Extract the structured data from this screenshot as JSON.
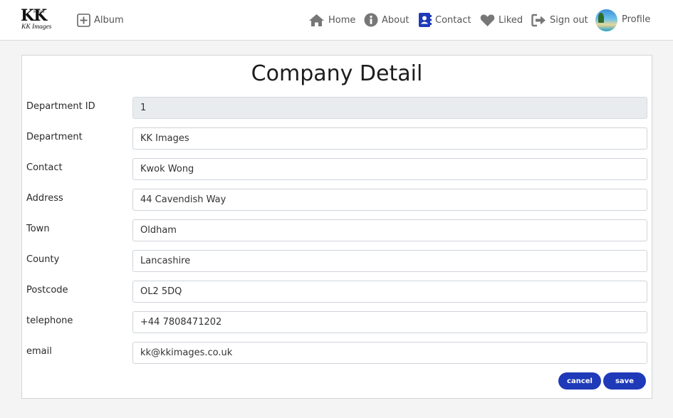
{
  "navbar": {
    "logo_text": "KK",
    "logo_small": "IMAGES",
    "logo_sub": "KK Images",
    "album_label": "Album",
    "home_label": "Home",
    "about_label": "About",
    "contact_label": "Contact",
    "liked_label": "Liked",
    "signout_label": "Sign out",
    "profile_label": "Profile"
  },
  "form": {
    "title": "Company Detail",
    "fields": [
      {
        "label": "Department ID",
        "value": "1",
        "readonly": true
      },
      {
        "label": "Department",
        "value": "KK Images"
      },
      {
        "label": "Contact",
        "value": "Kwok Wong"
      },
      {
        "label": "Address",
        "value": "44 Cavendish Way"
      },
      {
        "label": "Town",
        "value": "Oldham"
      },
      {
        "label": "County",
        "value": "Lancashire"
      },
      {
        "label": "Postcode",
        "value": "OL2 5DQ"
      },
      {
        "label": "telephone",
        "value": "+44 7808471202"
      },
      {
        "label": "email",
        "value": "kk@kkimages.co.uk"
      }
    ],
    "cancel_label": "cancel",
    "save_label": "save"
  },
  "colors": {
    "primary_button": "#1e3ab8",
    "contact_icon": "#1e3ab8",
    "nav_icon": "#777777"
  }
}
